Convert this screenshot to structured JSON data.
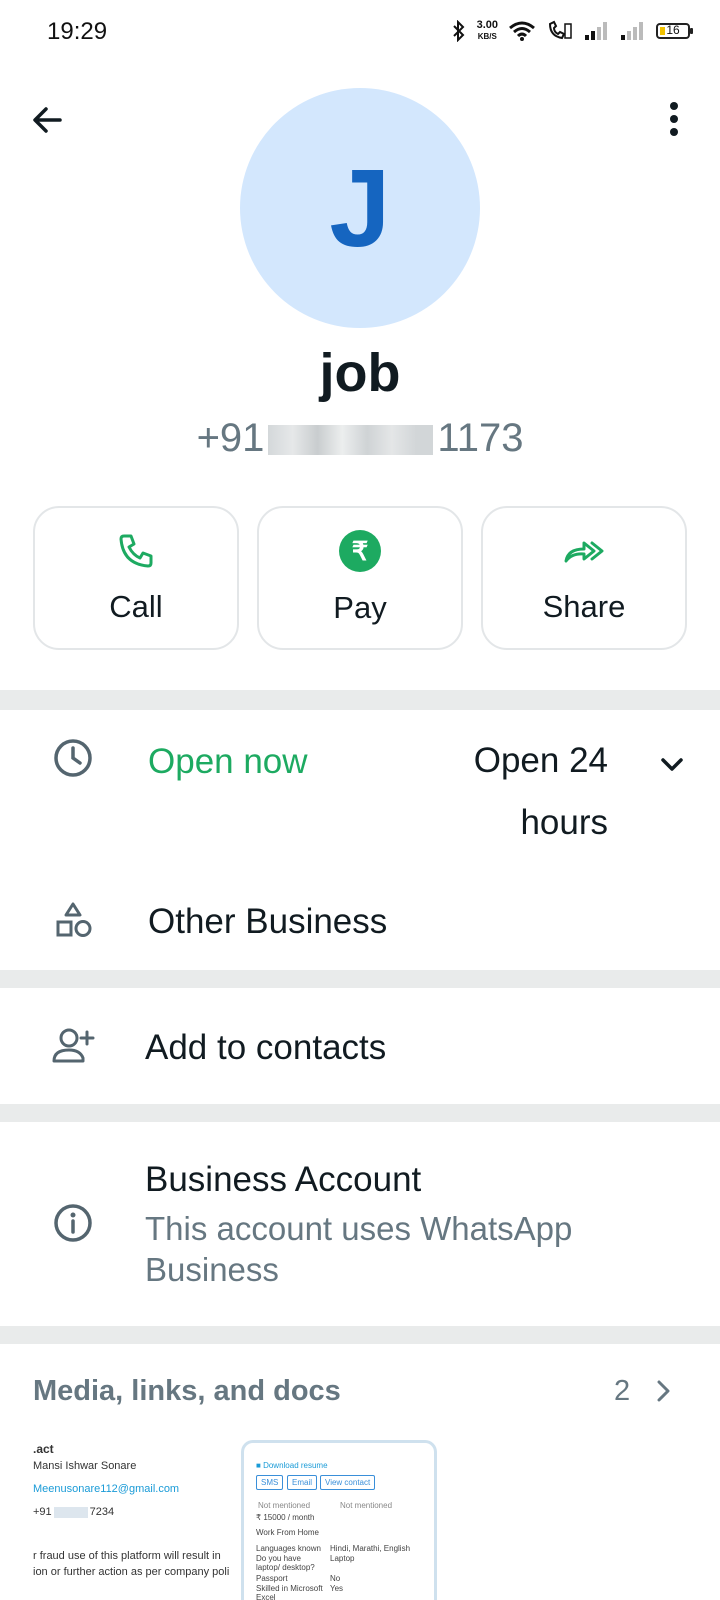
{
  "status_bar": {
    "time": "19:29",
    "speed_value": "3.00",
    "speed_unit": "KB/S",
    "battery": "16"
  },
  "header": {
    "avatar_letter": "J",
    "name": "job",
    "phone_prefix": "+91",
    "phone_suffix": "1173",
    "icons": {
      "back": "back-arrow-icon",
      "more": "more-vert-icon"
    }
  },
  "actions": [
    {
      "label": "Call",
      "icon": "phone-icon"
    },
    {
      "label": "Pay",
      "icon": "rupee-icon",
      "glyph": "₹"
    },
    {
      "label": "Share",
      "icon": "share-forward-icon"
    }
  ],
  "hours": {
    "status": "Open now",
    "hours": "Open 24 hours",
    "category": "Other Business"
  },
  "add_contact": {
    "label": "Add to contacts"
  },
  "business": {
    "title": "Business Account",
    "subtitle": "This account uses WhatsApp Business"
  },
  "media": {
    "title": "Media, links, and docs",
    "count": "2",
    "thumb1": {
      "line1": ".act",
      "line2": "Mansi Ishwar Sonare",
      "line3": "Meenusonare112@gmail.com",
      "line4_prefix": "+91",
      "line4_suffix": "7234",
      "line5": "r fraud use of this platform will result in",
      "line6": "ion or further action as per company poli"
    },
    "thumb2": {
      "download": "Download resume",
      "pills": [
        "SMS",
        "Email",
        "View contact"
      ],
      "not_mentioned_1": "Not mentioned",
      "not_mentioned_2": "Not mentioned",
      "salary": "15000 / month",
      "work": "Work From Home",
      "rows": [
        {
          "k": "Languages known",
          "v": "Hindi, Marathi, English"
        },
        {
          "k": "Do you have laptop/ desktop?",
          "v": "Laptop"
        },
        {
          "k": "Passport",
          "v": "No"
        },
        {
          "k": "Skilled in Microsoft Excel",
          "v": "Yes"
        }
      ]
    }
  },
  "colors": {
    "accent_green": "#1daa61",
    "avatar_bg": "#d3e7fd",
    "avatar_fg": "#1565c0",
    "secondary_text": "#667781"
  }
}
